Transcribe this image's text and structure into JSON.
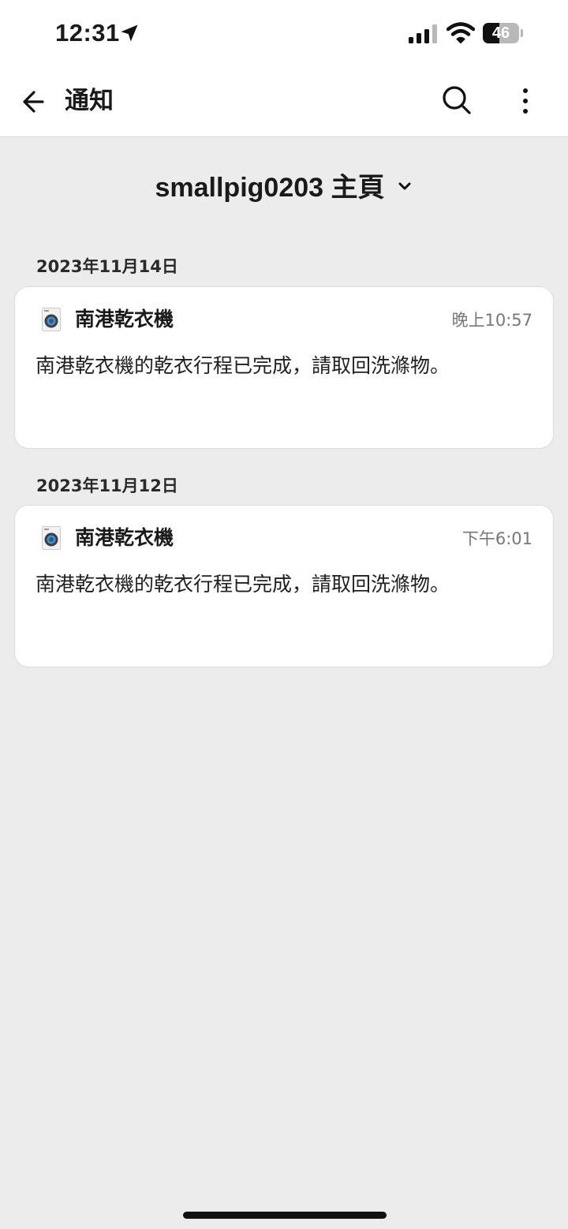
{
  "status_bar": {
    "time": "12:31",
    "battery_level": "46",
    "battery_fraction": 0.46,
    "icons": [
      "location-arrow-icon",
      "cellular-signal-icon",
      "wifi-icon",
      "battery-icon"
    ]
  },
  "header": {
    "title": "通知",
    "icons": [
      "back-arrow-icon",
      "search-icon",
      "more-vertical-icon"
    ]
  },
  "home_selector": {
    "label": "smallpig0203 主頁"
  },
  "notifications": [
    {
      "date": "2023年11月14日",
      "device": "南港乾衣機",
      "time": "晚上10:57",
      "message": "南港乾衣機的乾衣行程已完成，請取回洗滌物。"
    },
    {
      "date": "2023年11月12日",
      "device": "南港乾衣機",
      "time": "下午6:01",
      "message": "南港乾衣機的乾衣行程已完成，請取回洗滌物。"
    }
  ],
  "colors": {
    "background": "#ececec",
    "card": "#ffffff",
    "text": "#1a1a1a",
    "muted_text": "#777777"
  }
}
